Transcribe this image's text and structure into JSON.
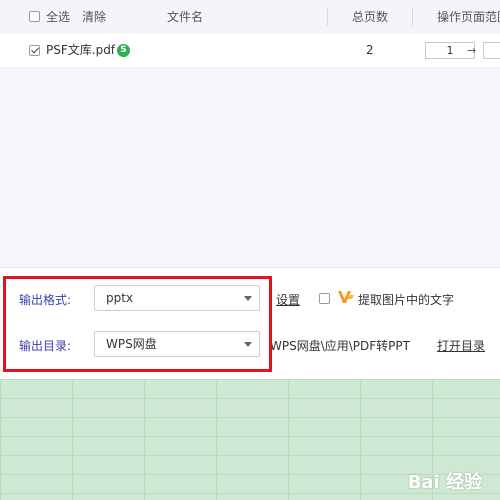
{
  "header": {
    "select_all": "全选",
    "clear": "清除",
    "file_name": "文件名",
    "total_pages": "总页数",
    "page_range": "操作页面范围"
  },
  "file_row": {
    "name": "PSF文库.pdf",
    "badge": "S",
    "pages": "2",
    "range_from": "1",
    "arrow": "→"
  },
  "settings": {
    "format_label": "输出格式:",
    "format_value": "pptx",
    "dir_label": "输出目录:",
    "dir_value": "WPS网盘",
    "settings_link": "设置",
    "extract_text_label": "提取图片中的文字",
    "output_path": "WPS网盘\\应用\\PDF转PPT",
    "open_dir_link": "打开目录"
  },
  "watermark": "Bai 经验",
  "colors": {
    "accent_label": "#3b3fa8",
    "highlight_box": "#e0141c",
    "badge_green": "#2ab24e",
    "sheet_green": "#cfe8d3"
  }
}
